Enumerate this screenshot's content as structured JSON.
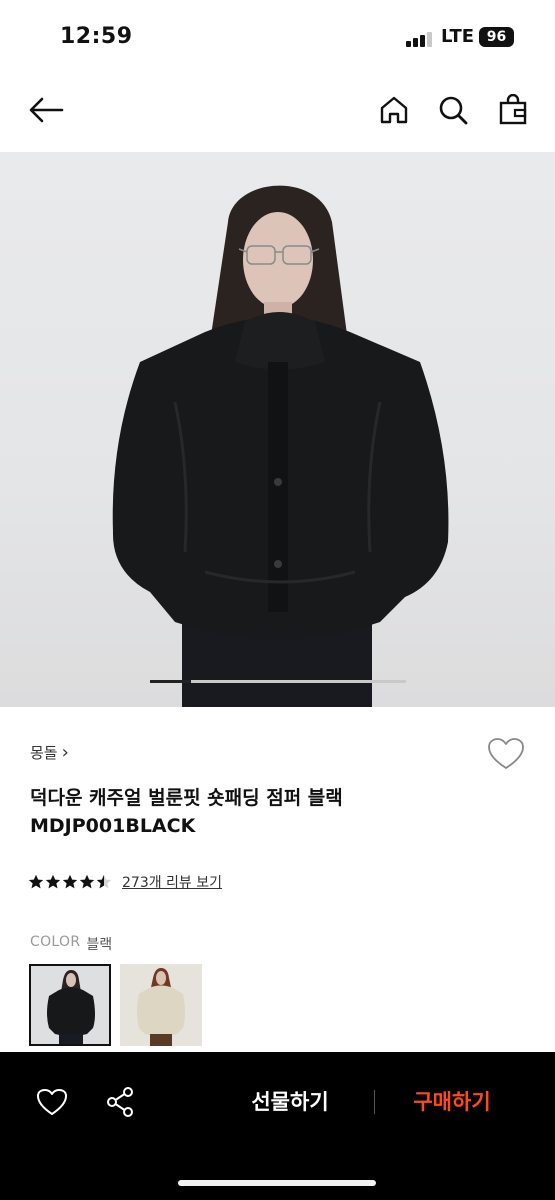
{
  "status_bar": {
    "time": "12:59",
    "network": "LTE",
    "battery": "96"
  },
  "nav": {
    "icons": [
      "back-arrow-icon",
      "home-icon",
      "search-icon",
      "shopping-bag-icon"
    ]
  },
  "carousel": {
    "current_fraction": 0.16
  },
  "product": {
    "brand": "몽돌",
    "brand_chevron": "›",
    "name": "덕다운 캐주얼 벌룬핏 숏패딩 점퍼 블랙",
    "code": "MDJP001BLACK",
    "rating": 4.5,
    "review_link": "273개 리뷰 보기"
  },
  "color": {
    "label": "COLOR",
    "value": "블랙",
    "swatches": [
      {
        "name": "black-jacket",
        "selected": true
      },
      {
        "name": "cream-jacket",
        "selected": false
      }
    ]
  },
  "bottom_bar": {
    "gift_label": "선물하기",
    "buy_label": "구매하기",
    "buy_color": "#ff4a1c"
  }
}
